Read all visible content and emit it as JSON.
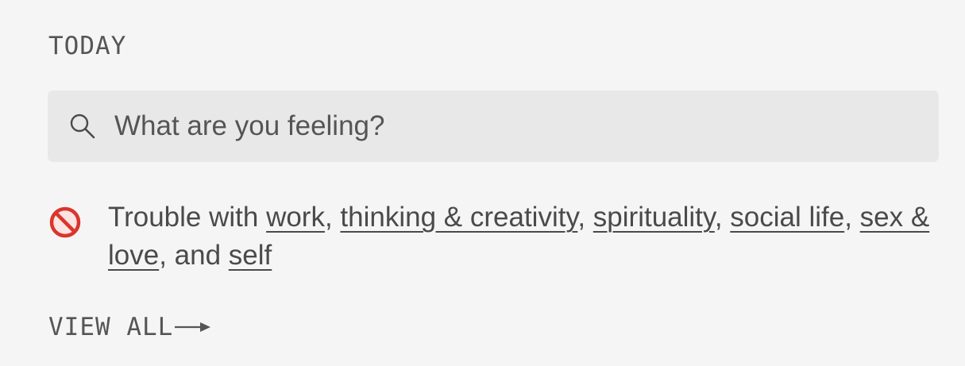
{
  "section": {
    "label": "TODAY"
  },
  "search": {
    "placeholder": "What are you feeling?",
    "icon": "search-icon"
  },
  "mood": {
    "icon": "prohibited-icon",
    "prefix": "Trouble with ",
    "links": [
      "work",
      "thinking & creativity",
      "spirituality",
      "social life",
      "sex & love",
      "self"
    ],
    "separators": [
      ", ",
      ", ",
      ", ",
      ", ",
      ", and "
    ]
  },
  "view_all": {
    "label": "VIEW ALL",
    "icon": "arrow-right-icon"
  },
  "colors": {
    "background": "#f5f5f5",
    "search_background": "#e8e8e8",
    "text": "#4a4a4a",
    "prohibited": "#d9362c"
  }
}
